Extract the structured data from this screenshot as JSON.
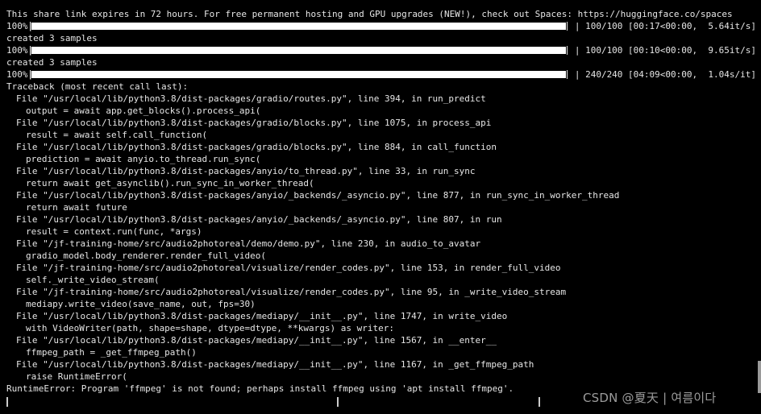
{
  "terminal": {
    "share_notice": "This share link expires in 72 hours. For free permanent hosting and GPU upgrades (NEW!), check out Spaces: https://huggingface.co/spaces",
    "progress_bars": [
      {
        "percent_label": "100%|",
        "fill_fraction": 1.0,
        "stats": "| 100/100 [00:17<00:00,  5.64it/s]"
      },
      {
        "percent_label": "100%|",
        "fill_fraction": 1.0,
        "stats": "| 100/100 [00:10<00:00,  9.65it/s]"
      },
      {
        "percent_label": "100%|",
        "fill_fraction": 1.0,
        "stats": "| 240/240 [04:09<00:00,  1.04s/it]"
      }
    ],
    "created_samples_1": "created 3 samples",
    "created_samples_2": "created 3 samples",
    "traceback_header": "Traceback (most recent call last):",
    "frames": [
      {
        "file": "File \"/usr/local/lib/python3.8/dist-packages/gradio/routes.py\", line 394, in run_predict",
        "code": "output = await app.get_blocks().process_api("
      },
      {
        "file": "File \"/usr/local/lib/python3.8/dist-packages/gradio/blocks.py\", line 1075, in process_api",
        "code": "result = await self.call_function("
      },
      {
        "file": "File \"/usr/local/lib/python3.8/dist-packages/gradio/blocks.py\", line 884, in call_function",
        "code": "prediction = await anyio.to_thread.run_sync("
      },
      {
        "file": "File \"/usr/local/lib/python3.8/dist-packages/anyio/to_thread.py\", line 33, in run_sync",
        "code": "return await get_asynclib().run_sync_in_worker_thread("
      },
      {
        "file": "File \"/usr/local/lib/python3.8/dist-packages/anyio/_backends/_asyncio.py\", line 877, in run_sync_in_worker_thread",
        "code": "return await future"
      },
      {
        "file": "File \"/usr/local/lib/python3.8/dist-packages/anyio/_backends/_asyncio.py\", line 807, in run",
        "code": "result = context.run(func, *args)"
      },
      {
        "file": "File \"/jf-training-home/src/audio2photoreal/demo/demo.py\", line 230, in audio_to_avatar",
        "code": "gradio_model.body_renderer.render_full_video("
      },
      {
        "file": "File \"/jf-training-home/src/audio2photoreal/visualize/render_codes.py\", line 153, in render_full_video",
        "code": "self._write_video_stream("
      },
      {
        "file": "File \"/jf-training-home/src/audio2photoreal/visualize/render_codes.py\", line 95, in _write_video_stream",
        "code": "mediapy.write_video(save_name, out, fps=30)"
      },
      {
        "file": "File \"/usr/local/lib/python3.8/dist-packages/mediapy/__init__.py\", line 1747, in write_video",
        "code": "with VideoWriter(path, shape=shape, dtype=dtype, **kwargs) as writer:"
      },
      {
        "file": "File \"/usr/local/lib/python3.8/dist-packages/mediapy/__init__.py\", line 1567, in __enter__",
        "code": "ffmpeg_path = _get_ffmpeg_path()"
      },
      {
        "file": "File \"/usr/local/lib/python3.8/dist-packages/mediapy/__init__.py\", line 1167, in _get_ffmpeg_path",
        "code": "raise RuntimeError("
      }
    ],
    "error_line": "RuntimeError: Program 'ffmpeg' is not found; perhaps install ffmpeg using 'apt install ffmpeg'."
  },
  "watermark": "CSDN @夏天 | 여름이다",
  "colors": {
    "background": "#000000",
    "text": "#e6e6e6",
    "watermark": "#9b9b9b"
  }
}
